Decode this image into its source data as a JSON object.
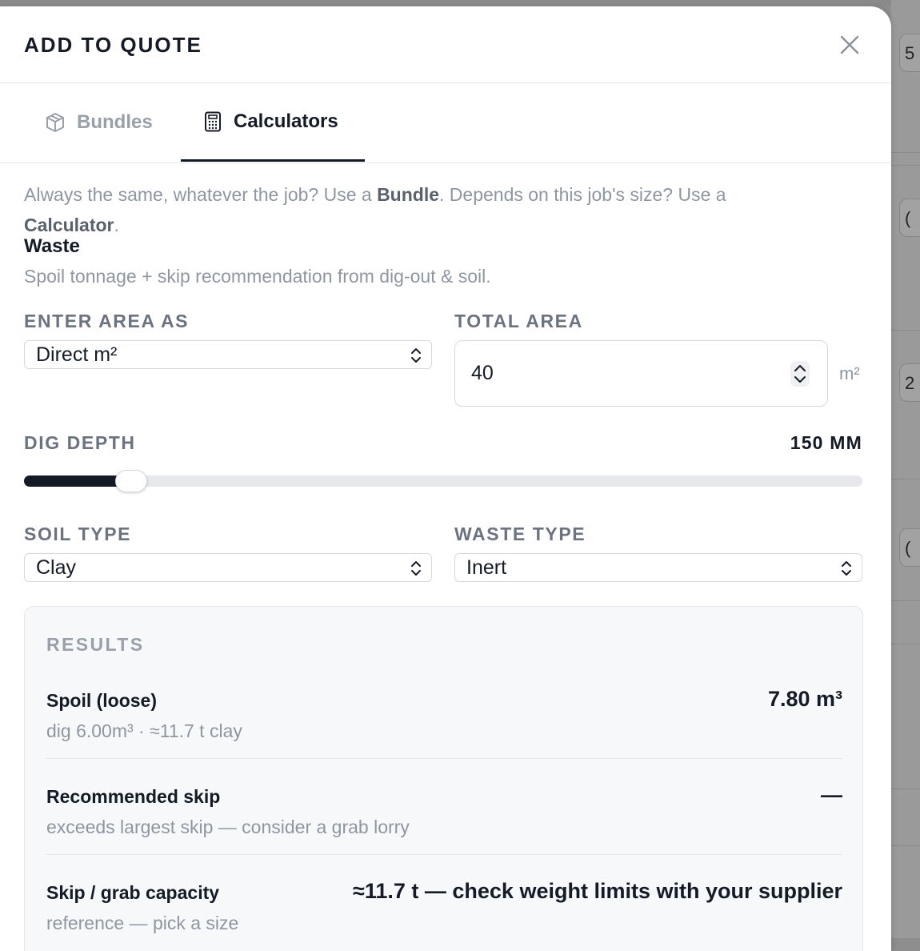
{
  "modal": {
    "title": "ADD TO QUOTE",
    "close_icon": "close-icon"
  },
  "tabs": [
    {
      "label": "Bundles",
      "icon": "box-icon",
      "active": false
    },
    {
      "label": "Calculators",
      "icon": "calculator-icon",
      "active": true
    }
  ],
  "intro": {
    "part1": "Always the same, whatever the job? Use a ",
    "bundle": "Bundle",
    "part2": ". Depends on this job's size? Use a ",
    "calculator": "Calculator",
    "part3": "."
  },
  "calculator": {
    "title": "Waste",
    "subtitle": "Spoil tonnage + skip recommendation from dig-out & soil.",
    "area_mode": {
      "label": "ENTER AREA AS",
      "value": "Direct m²"
    },
    "total_area": {
      "label": "TOTAL AREA",
      "value": "40",
      "unit": "m²"
    },
    "dig_depth": {
      "label": "DIG DEPTH",
      "value_text": "150 MM",
      "fraction": 0.12
    },
    "soil_type": {
      "label": "SOIL TYPE",
      "value": "Clay"
    },
    "waste_type": {
      "label": "WASTE TYPE",
      "value": "Inert"
    }
  },
  "results": {
    "title": "RESULTS",
    "rows": [
      {
        "name": "Spoil (loose)",
        "note": "dig 6.00m³ · ≈11.7 t clay",
        "value": "7.80 m³"
      },
      {
        "name": "Recommended skip",
        "note": "exceeds largest skip — consider a grab lorry",
        "value": "—"
      },
      {
        "name": "Skip / grab capacity",
        "note": "reference — pick a size",
        "value": "≈11.7 t — check weight limits with your supplier"
      }
    ]
  },
  "background": {
    "chips": [
      "5",
      "(",
      "2",
      "("
    ]
  }
}
